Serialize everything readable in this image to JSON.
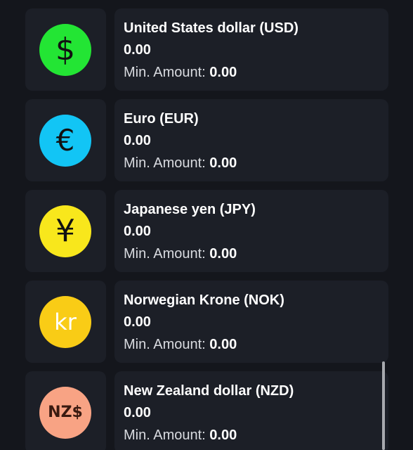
{
  "currencies": [
    {
      "icon": "dollar-sign-icon",
      "symbol": "$",
      "color": "#23e534",
      "name": "United States dollar (USD)",
      "balance": "0.00",
      "min_label": "Min. Amount:",
      "min_value": "0.00"
    },
    {
      "icon": "euro-sign-icon",
      "symbol": "€",
      "color": "#12c5f5",
      "name": "Euro (EUR)",
      "balance": "0.00",
      "min_label": "Min. Amount:",
      "min_value": "0.00"
    },
    {
      "icon": "yen-sign-icon",
      "symbol": "¥",
      "color": "#f8e71c",
      "name": "Japanese yen (JPY)",
      "balance": "0.00",
      "min_label": "Min. Amount:",
      "min_value": "0.00"
    },
    {
      "icon": "krone-sign-icon",
      "symbol": "kr",
      "color": "#f9cc16",
      "name": "Norwegian Krone (NOK)",
      "balance": "0.00",
      "min_label": "Min. Amount:",
      "min_value": "0.00"
    },
    {
      "icon": "nzd-sign-icon",
      "symbol": "NZ$",
      "color": "#f8a384",
      "name": "New Zealand dollar (NZD)",
      "balance": "0.00",
      "min_label": "Min. Amount:",
      "min_value": "0.00"
    }
  ]
}
